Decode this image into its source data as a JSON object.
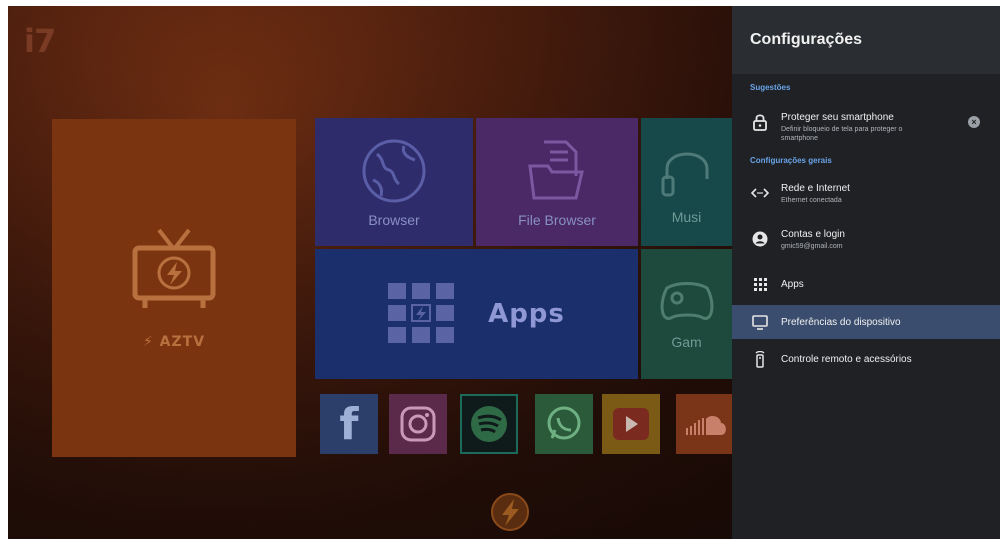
{
  "launcher": {
    "logo": "i7",
    "tiles": {
      "aztv": "AZTV",
      "browser": "Browser",
      "file_browser": "File Browser",
      "music": "Musi",
      "apps": "Apps",
      "games": "Gam"
    },
    "app_row": [
      "facebook-icon",
      "instagram-icon",
      "spotify-icon",
      "whatsapp-icon",
      "youtube-icon",
      "soundcloud-icon"
    ]
  },
  "settings": {
    "title": "Configurações",
    "suggestions_header": "Sugestões",
    "suggestion": {
      "title": "Proteger seu smartphone",
      "subtitle": "Definir bloqueio de tela para proteger o smartphone"
    },
    "general_header": "Configurações gerais",
    "items": [
      {
        "title": "Rede e Internet",
        "subtitle": "Ethernet conectada",
        "icon": "network-arrows-icon"
      },
      {
        "title": "Contas e login",
        "subtitle": "gmic59@gmail.com",
        "icon": "account-icon"
      },
      {
        "title": "Apps",
        "subtitle": "",
        "icon": "apps-grid-icon"
      },
      {
        "title": "Preferências do dispositivo",
        "subtitle": "",
        "icon": "tv-monitor-icon",
        "selected": true
      },
      {
        "title": "Controle remoto e acessórios",
        "subtitle": "",
        "icon": "remote-icon"
      }
    ]
  },
  "colors": {
    "panel_bg": "#1f2124",
    "panel_header_bg": "#2a2d31",
    "selected_bg": "#3a4d6e",
    "section_header": "#6aa4e8"
  }
}
